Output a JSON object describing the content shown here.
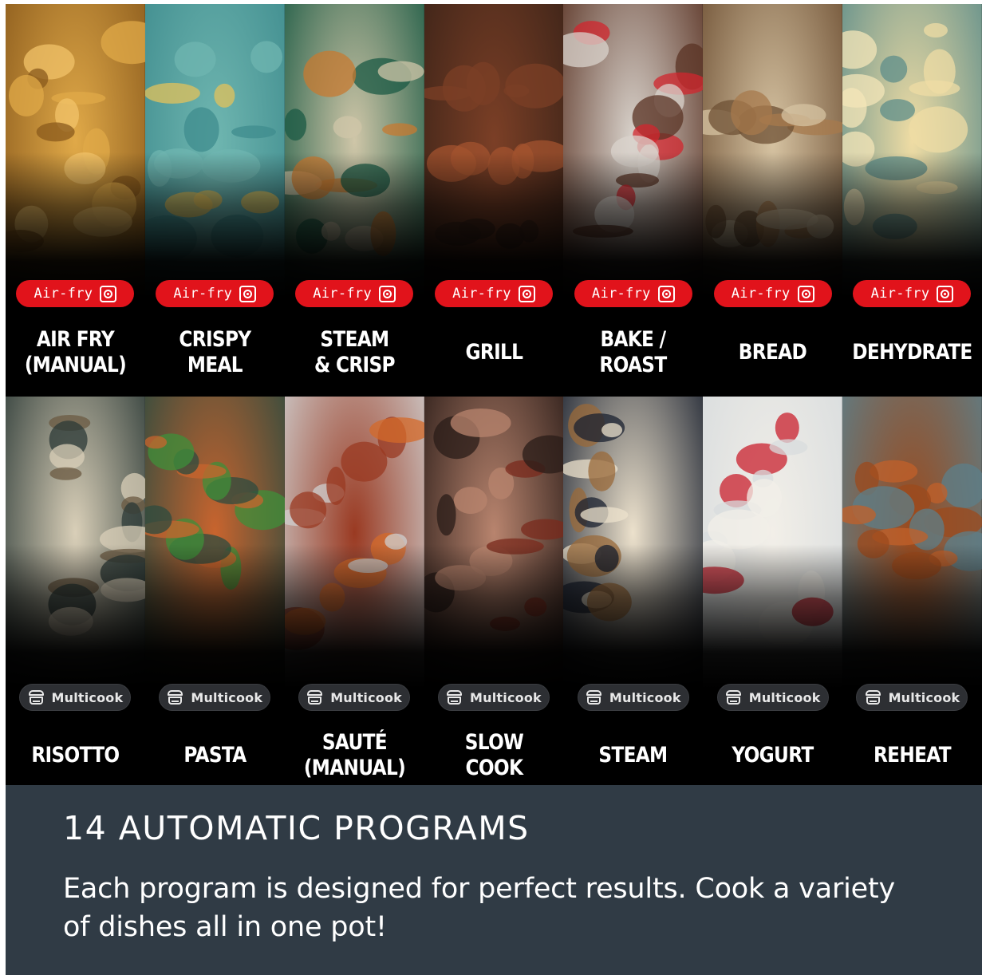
{
  "tiles_top": [
    {
      "badge": "Air-fry",
      "label": "AIR FRY\n(MANUAL)",
      "photo": "french-fries",
      "bg": "#8a5a1c",
      "bg2": "#e0a948",
      "accent": "#f2c36a"
    },
    {
      "badge": "Air-fry",
      "label": "CRISPY\nMEAL",
      "photo": "chicken-veg-bowl",
      "bg": "#3f8c8e",
      "bg2": "#6fb6b0",
      "accent": "#e2c25b"
    },
    {
      "badge": "Air-fry",
      "label": "STEAM\n& CRISP",
      "photo": "rice-chicken-bowl",
      "bg": "#1b5a44",
      "bg2": "#cfc6a8",
      "accent": "#c77a30"
    },
    {
      "badge": "Air-fry",
      "label": "GRILL",
      "photo": "steak",
      "bg": "#3b2318",
      "bg2": "#7b3f26",
      "accent": "#a3532f"
    },
    {
      "badge": "Air-fry",
      "label": "BAKE /\nROAST",
      "photo": "chocolate-cake",
      "bg": "#5a3324",
      "bg2": "#d9d3cc",
      "accent": "#d2262d"
    },
    {
      "badge": "Air-fry",
      "label": "BREAD",
      "photo": "bread-loaf",
      "bg": "#6e5034",
      "bg2": "#d6c3a2",
      "accent": "#a77a4c"
    },
    {
      "badge": "Air-fry",
      "label": "DEHYDRATE",
      "photo": "apple-chips",
      "bg": "#5e8d8a",
      "bg2": "#efdca4",
      "accent": "#f4e6b8"
    }
  ],
  "tiles_bottom": [
    {
      "badge": "Multicook",
      "label": "RISOTTO",
      "photo": "mushroom-risotto",
      "bg": "#2c3a37",
      "bg2": "#d9cfb8",
      "accent": "#6b5a42"
    },
    {
      "badge": "Multicook",
      "label": "PASTA",
      "photo": "penne-pasta",
      "bg": "#2e4b3f",
      "bg2": "#c8642e",
      "accent": "#3f8f3a"
    },
    {
      "badge": "Multicook",
      "label": "SAUTÉ\n(MANUAL)",
      "photo": "beef-stew",
      "bg": "#cfcfcf",
      "bg2": "#9a3a22",
      "accent": "#d46a2a"
    },
    {
      "badge": "Multicook",
      "label": "SLOW\nCOOK",
      "photo": "pulled-pork",
      "bg": "#2a1c18",
      "bg2": "#b8846e",
      "accent": "#7a2a1c"
    },
    {
      "badge": "Multicook",
      "label": "STEAM",
      "photo": "steamed-buns",
      "bg": "#1b2230",
      "bg2": "#ece1cc",
      "accent": "#9a6a3a"
    },
    {
      "badge": "Multicook",
      "label": "YOGURT",
      "photo": "yogurt-cups",
      "bg": "#d8dcde",
      "bg2": "#f2efe8",
      "accent": "#c9202e"
    },
    {
      "badge": "Multicook",
      "label": "REHEAT",
      "photo": "chicken-wings",
      "bg": "#5c7f8a",
      "bg2": "#9c4a1c",
      "accent": "#c2602a"
    }
  ],
  "banner": {
    "title": "14 AUTOMATIC PROGRAMS",
    "subtitle": "Each program is designed for perfect results. Cook a variety of dishes all in one pot!"
  },
  "icons": {
    "air_fry": "fan-icon",
    "multicook": "pot-icon"
  },
  "colors": {
    "air_badge": "#e1131b",
    "multi_badge": "#2d2f33",
    "banner_bg": "#303b45"
  }
}
